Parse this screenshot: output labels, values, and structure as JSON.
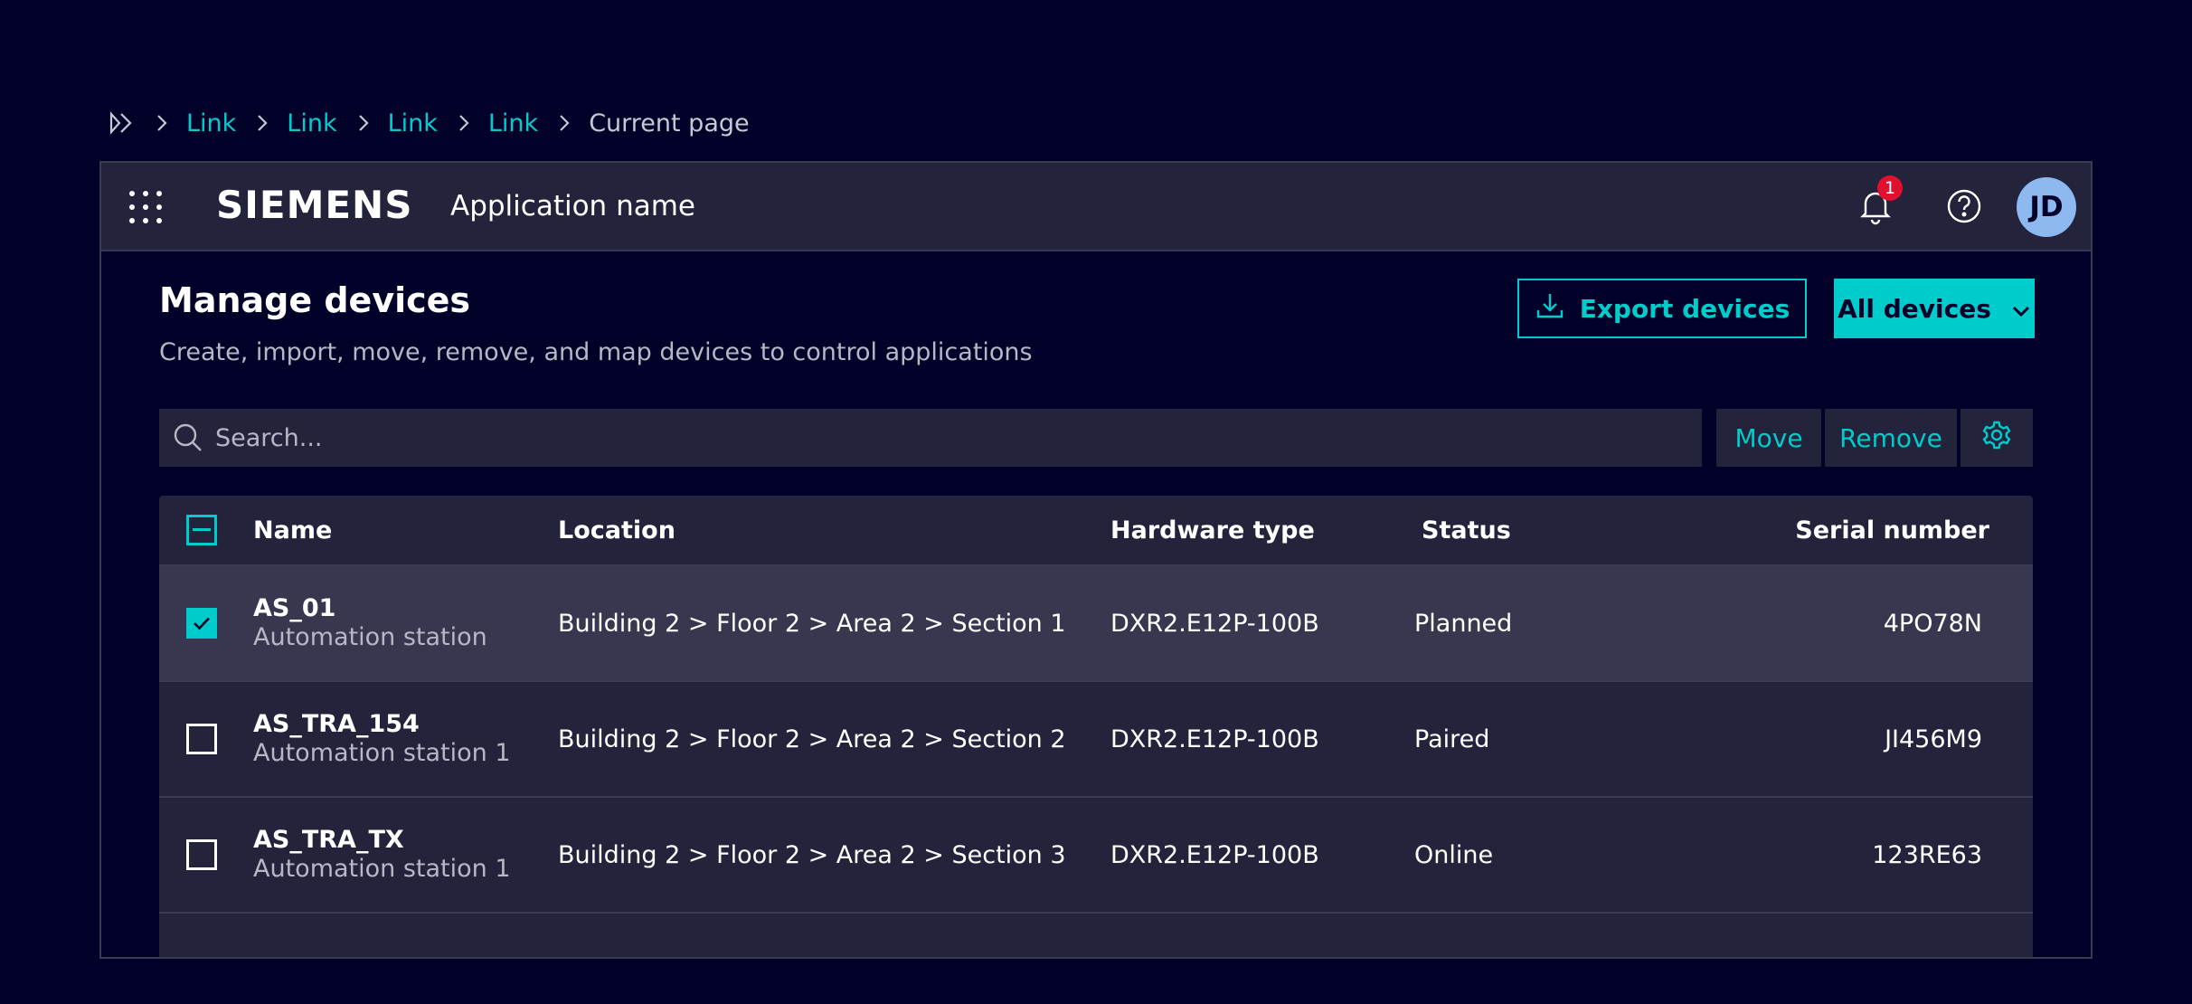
{
  "breadcrumb": {
    "links": [
      "Link",
      "Link",
      "Link",
      "Link"
    ],
    "current": "Current page"
  },
  "header": {
    "brand": "SIEMENS",
    "app_name": "Application name",
    "notification_count": "1",
    "avatar_initials": "JD"
  },
  "page": {
    "title": "Manage devices",
    "subtitle": "Create, import, move, remove, and map devices to control applications",
    "export_label": "Export devices",
    "filter_label": "All devices"
  },
  "toolbar": {
    "search_placeholder": "Search...",
    "move_label": "Move",
    "remove_label": "Remove"
  },
  "table": {
    "columns": {
      "name": "Name",
      "location": "Location",
      "hardware": "Hardware type",
      "status": "Status",
      "serial": "Serial number"
    },
    "rows": [
      {
        "name": "AS_01",
        "type": "Automation station",
        "location": "Building 2 > Floor 2 > Area 2 > Section 1",
        "hardware": "DXR2.E12P-100B",
        "status": "Planned",
        "serial": "4PO78N",
        "selected": true
      },
      {
        "name": "AS_TRA_154",
        "type": "Automation station 1",
        "location": "Building 2 > Floor 2 > Area 2 > Section 2",
        "hardware": "DXR2.E12P-100B",
        "status": "Paired",
        "serial": "JI456M9",
        "selected": false
      },
      {
        "name": "AS_TRA_TX",
        "type": "Automation station 1",
        "location": "Building 2 > Floor 2 > Area 2 > Section 3",
        "hardware": "DXR2.E12P-100B",
        "status": "Online",
        "serial": "123RE63",
        "selected": false
      }
    ]
  },
  "colors": {
    "background": "#000028",
    "accent": "#00cccc",
    "surface": "#23233c",
    "badge": "#e0102e"
  }
}
